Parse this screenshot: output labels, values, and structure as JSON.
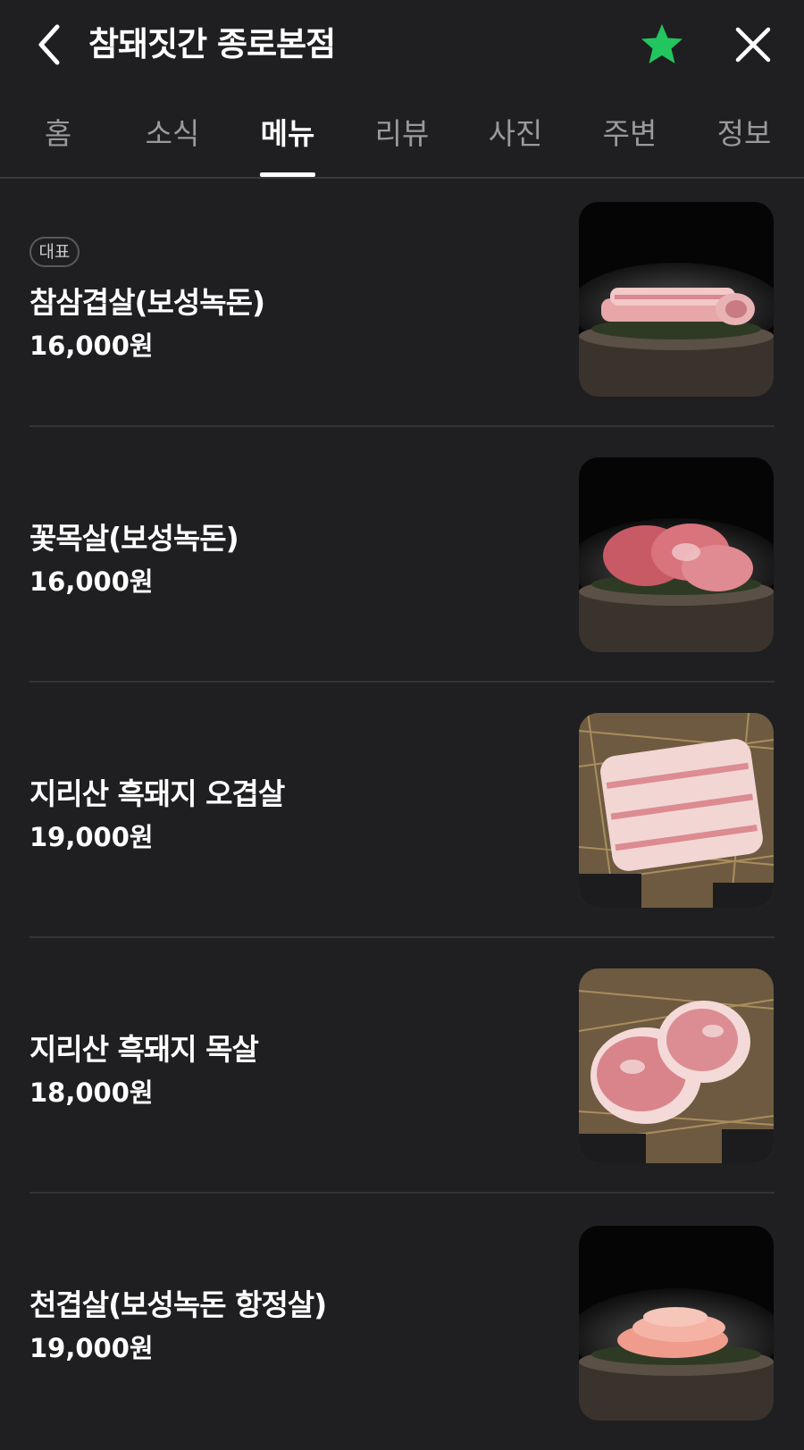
{
  "header": {
    "title": "참돼짓간 종로본점",
    "back_icon": "chevron-left-icon",
    "favorite_icon": "star-icon",
    "close_icon": "close-icon",
    "favorite_color": "#22c55e"
  },
  "tabs": [
    {
      "label": "홈",
      "active": false
    },
    {
      "label": "소식",
      "active": false
    },
    {
      "label": "메뉴",
      "active": true
    },
    {
      "label": "리뷰",
      "active": false
    },
    {
      "label": "사진",
      "active": false
    },
    {
      "label": "주변",
      "active": false
    },
    {
      "label": "정보",
      "active": false
    }
  ],
  "menu": [
    {
      "badge": "대표",
      "name": "참삼겹살(보성녹돈)",
      "price": "16,000원",
      "image": "pork-belly-on-wood-stump"
    },
    {
      "name": "꽃목살(보성녹돈)",
      "price": "16,000원",
      "image": "pork-neck-on-wood-stump"
    },
    {
      "name": "지리산 흑돼지 오겹살",
      "price": "19,000원",
      "image": "pork-belly-on-straw"
    },
    {
      "name": "지리산 흑돼지 목살",
      "price": "18,000원",
      "image": "pork-neck-on-straw"
    },
    {
      "name": "천겹살(보성녹돈 항정살)",
      "price": "19,000원",
      "image": "pork-jowl-on-wood-stump"
    }
  ]
}
